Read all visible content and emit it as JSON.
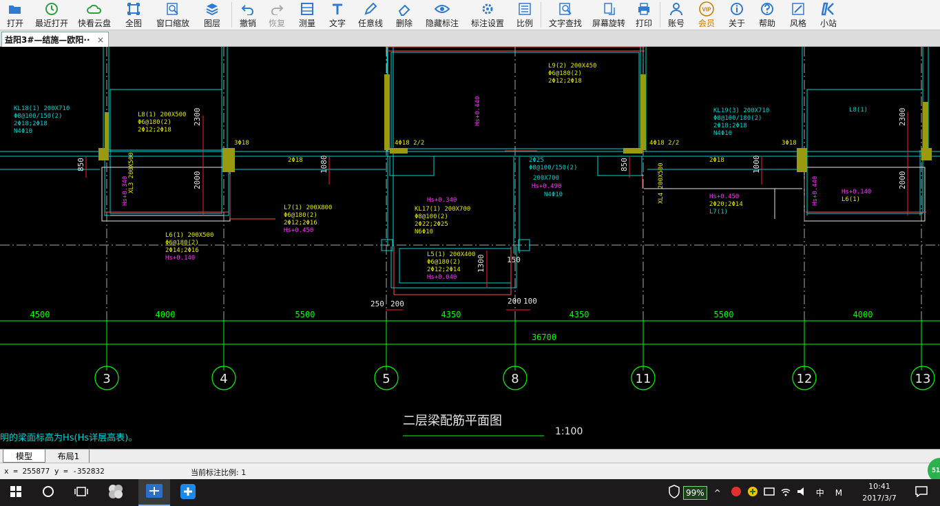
{
  "toolbar": {
    "buttons": [
      {
        "label": "打开",
        "icon": "folder-open-icon"
      },
      {
        "label": "最近打开",
        "icon": "clock-icon"
      },
      {
        "label": "快看云盘",
        "icon": "cloud-icon"
      },
      {
        "label": "全图",
        "icon": "zoom-extents-icon"
      },
      {
        "label": "窗口缩放",
        "icon": "zoom-window-icon"
      },
      {
        "label": "图层",
        "icon": "layers-icon"
      },
      {
        "label": "撤销",
        "icon": "undo-icon"
      },
      {
        "label": "恢复",
        "icon": "redo-icon"
      },
      {
        "label": "测量",
        "icon": "measure-icon"
      },
      {
        "label": "文字",
        "icon": "text-icon"
      },
      {
        "label": "任意线",
        "icon": "pen-icon"
      },
      {
        "label": "删除",
        "icon": "eraser-icon"
      },
      {
        "label": "隐藏标注",
        "icon": "eye-icon"
      },
      {
        "label": "标注设置",
        "icon": "annotation-settings-icon"
      },
      {
        "label": "比例",
        "icon": "scale-ruler-icon"
      },
      {
        "label": "文字查找",
        "icon": "text-search-icon"
      },
      {
        "label": "屏幕旋转",
        "icon": "rotate-screen-icon"
      },
      {
        "label": "打印",
        "icon": "printer-icon"
      },
      {
        "label": "账号",
        "icon": "user-icon"
      },
      {
        "label": "会员",
        "icon": "vip-icon"
      },
      {
        "label": "关于",
        "icon": "info-icon"
      },
      {
        "label": "帮助",
        "icon": "help-icon"
      },
      {
        "label": "风格",
        "icon": "style-icon"
      },
      {
        "label": "小站",
        "icon": "station-icon"
      }
    ],
    "vip_text": "VIP"
  },
  "tab": {
    "title": "益阳3#—结施—欧阳··",
    "close": "×"
  },
  "drawing": {
    "title": "二层梁配筋平面图",
    "scale": "1:100",
    "axes": [
      "3",
      "4",
      "5",
      "8",
      "11",
      "12",
      "13"
    ],
    "bay_dimensions": [
      "4500",
      "4000",
      "5500",
      "4350",
      "4350",
      "5500",
      "4000"
    ],
    "total_dimension": "36700",
    "note_line": "明的梁面标高为Hs(Hs详层高表)。",
    "labels": {
      "kl18": "KL18(1) 200X710",
      "kl18_a": "Φ8@100/150(2)",
      "kl18_b": "2Φ18;2Φ18",
      "kl18_c": "N4Φ10",
      "l8": "L8(1) 200X500",
      "l8_a": "Φ6@180(2)",
      "l8_b": "2Φ12;2Φ18",
      "xl3": "XL3 200X500",
      "l6": "L6(1) 200X500",
      "l6_a": "Φ6@180(2)",
      "l6_b": "2Φ14;2Φ16",
      "l6_c": "Hs+0.140",
      "l7": "L7(1) 200X800",
      "l7_a": "Φ6@180(2)",
      "l7_b": "2Φ12;2Φ16",
      "l7_c": "Hs+0.450",
      "l9": "L9(2) 200X450",
      "l9_a": "Φ6@180(2)",
      "l9_b": "2Φ12;2Φ18",
      "kl17": "KL17(1) 200X700",
      "kl17_a": "Φ8@100(2)",
      "kl17_b": "2Φ22;2Φ25",
      "kl17_c": "N6Φ10",
      "kl17_hs": "Hs+0.340",
      "l5": "L5(1) 200X400",
      "l5_a": "Φ6@180(2)",
      "l5_b": "2Φ12;2Φ14",
      "l5_c": "Hs+0.040",
      "kl_top": "2Φ25",
      "kl_top_a": "Φ8@100/150(2)",
      "kl_top_b": "200X700",
      "kl_top_c": "Hs+0.490",
      "kl_top_d": "N4Φ10",
      "kl19": "KL19(3) 200X710",
      "kl19_a": "Φ8@100/180(2)",
      "kl19_b": "2Φ18;2Φ18",
      "kl19_c": "N4Φ10",
      "l8r": "L8(1)",
      "l6r": "L6(1)",
      "l6r_hs": "Hs+0.140",
      "l7r": "L7(1)",
      "l7r_hs": "Hs+0.450",
      "xl4": "XL4 200X500",
      "xl4_a": "2Φ20;2Φ14",
      "dim850": "850",
      "dim1080": "1080",
      "dim2000": "2000",
      "dim2300": "2300",
      "dim1000": "1000",
      "dim1300": "1300",
      "dim250": "250",
      "dim200": "200",
      "dim200b": "200",
      "dim100": "100",
      "dim150": "150",
      "rebar": "4Φ18 2/2",
      "rebar2": "2Φ18",
      "rebar3": "3Φ18",
      "hs340": "Hs+0.340",
      "hs440": "Hs+0.440"
    }
  },
  "layout_tabs": {
    "model": "模型",
    "layout": "布局1"
  },
  "status": {
    "coords": "x = 255877  y = -352832",
    "scale_label": "当前标注比例: 1",
    "badge": "51"
  },
  "taskbar": {
    "battery": "99%",
    "ime_lang": "中",
    "ime_mode": "M",
    "time": "10:41",
    "date": "2017/3/7"
  },
  "colors": {
    "cyan": "#00d2d2",
    "green": "#00ff00",
    "magenta": "#ff30ff",
    "yellow": "#e6e600",
    "red": "#ff2020",
    "white": "#e8e8e8",
    "column": "#9a9a10"
  }
}
